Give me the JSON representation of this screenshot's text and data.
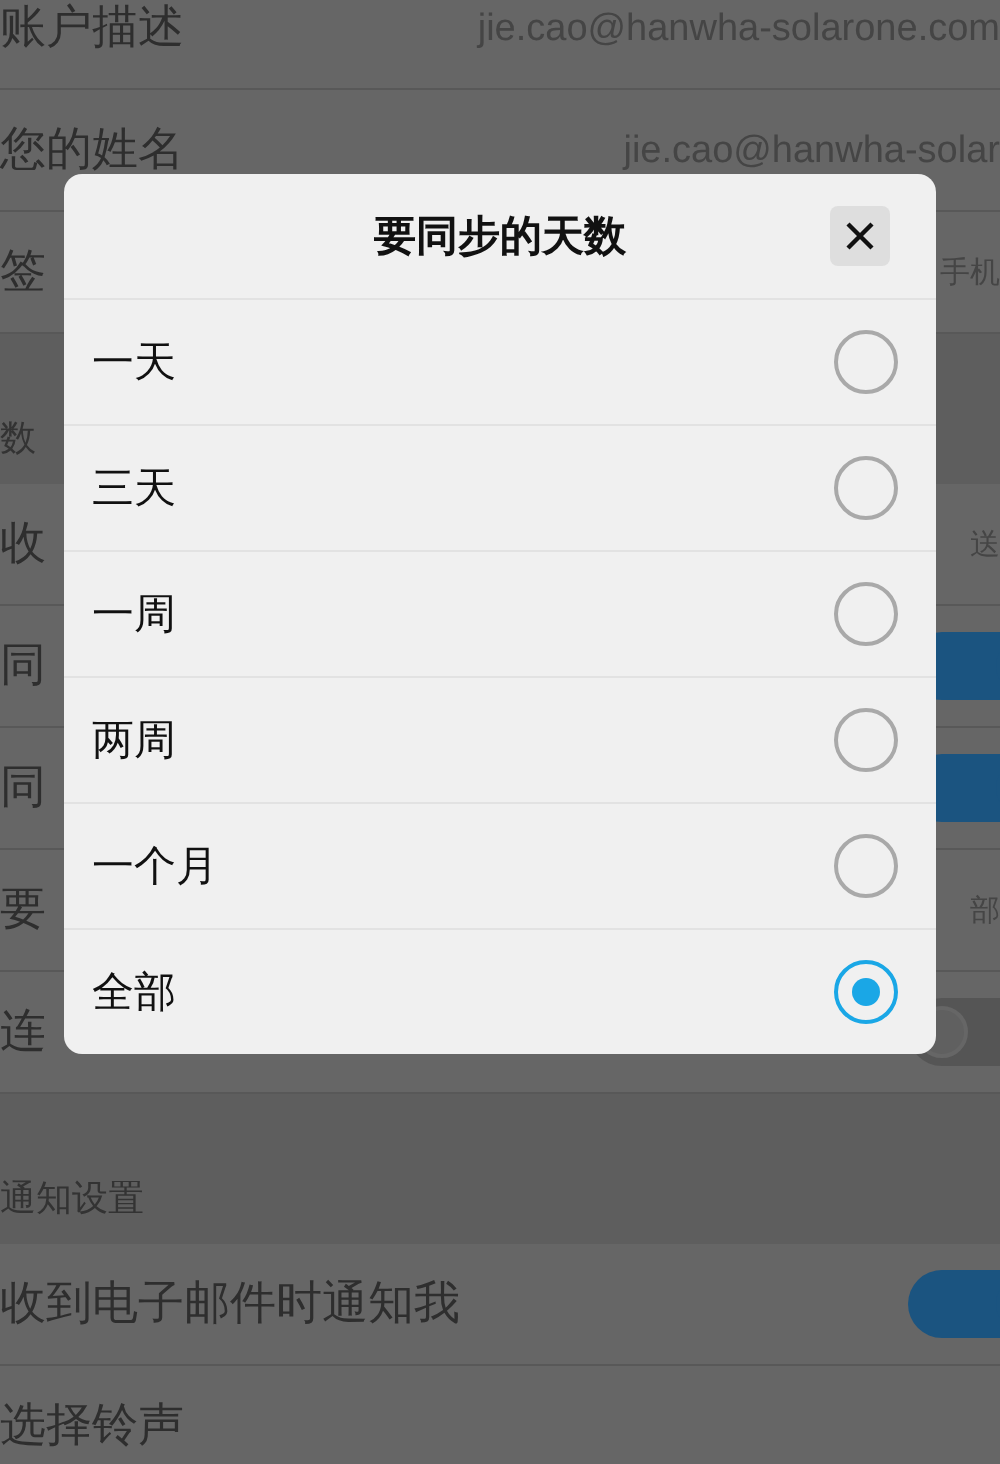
{
  "sections": [
    {
      "rows": [
        {
          "kind": "text",
          "label": "账户描述",
          "value": "jie.cao@hanwha-solarone.com"
        },
        {
          "kind": "text",
          "label": "您的姓名",
          "value": "jie.cao@hanwha-solar"
        },
        {
          "kind": "text",
          "label": "签",
          "value": "手机"
        }
      ]
    },
    {
      "header": "数",
      "rows": [
        {
          "kind": "text",
          "label": "收",
          "value": "送"
        },
        {
          "kind": "toggle",
          "label": "同",
          "on": true
        },
        {
          "kind": "toggle",
          "label": "同",
          "on": true
        },
        {
          "kind": "text",
          "label": "要",
          "value": "部"
        },
        {
          "kind": "toggle",
          "label": "连",
          "on": false
        }
      ]
    },
    {
      "header": "通知设置",
      "rows": [
        {
          "kind": "toggle",
          "label": "收到电子邮件时通知我",
          "on": true
        },
        {
          "kind": "text",
          "label": "选择铃声"
        }
      ]
    }
  ],
  "dialog": {
    "title": "要同步的天数",
    "options": [
      {
        "label": "一天",
        "selected": false
      },
      {
        "label": "三天",
        "selected": false
      },
      {
        "label": "一周",
        "selected": false
      },
      {
        "label": "两周",
        "selected": false
      },
      {
        "label": "一个月",
        "selected": false
      },
      {
        "label": "全部",
        "selected": true
      }
    ]
  }
}
